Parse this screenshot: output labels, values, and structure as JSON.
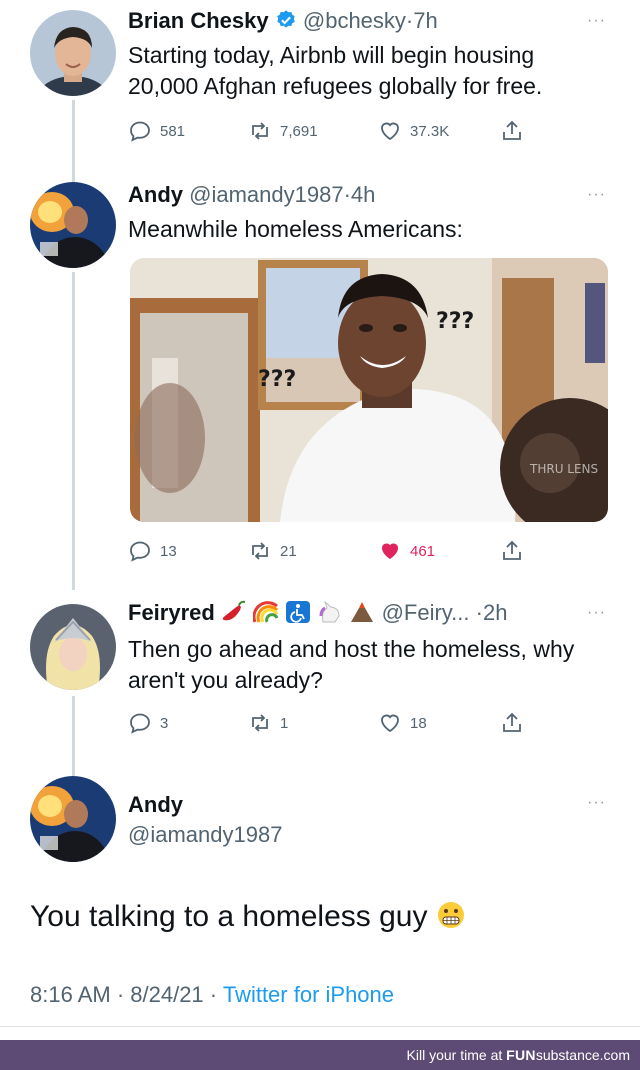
{
  "tweets": [
    {
      "name": "Brian Chesky",
      "handle": "@bchesky",
      "time": "7h",
      "text": "Starting today, Airbnb will begin housing 20,000 Afghan refugees globally for free.",
      "replies": "581",
      "retweets": "7,691",
      "likes": "37.3K"
    },
    {
      "name": "Andy",
      "handle": "@iamandy1987",
      "time": "4h",
      "text": "Meanwhile homeless Americans:",
      "replies": "13",
      "retweets": "21",
      "likes": "461",
      "media": {
        "caption_left": "???",
        "caption_right": "???",
        "watermark": "THRU LENS"
      }
    },
    {
      "name": "Feiryred",
      "handle": "@Feiry...",
      "time": "2h",
      "text": "Then go ahead and host the homeless, why aren't you already?",
      "replies": "3",
      "retweets": "1",
      "likes": "18"
    }
  ],
  "main_tweet": {
    "name": "Andy",
    "handle": "@iamandy1987",
    "text": "You talking to a homeless guy",
    "timestamp": "8:16 AM · 8/24/21 · ",
    "source": "Twitter for iPhone"
  },
  "more_icon": "···",
  "separator": "·",
  "colors": {
    "like_active": "#e0245e",
    "link": "#1d9bf0",
    "verified": "#1d9bf0",
    "footer_bg": "#5e4b75"
  },
  "footer": {
    "prefix": "Kill your time at ",
    "brand_bold": "FUN",
    "brand_rest": "substance.com"
  }
}
